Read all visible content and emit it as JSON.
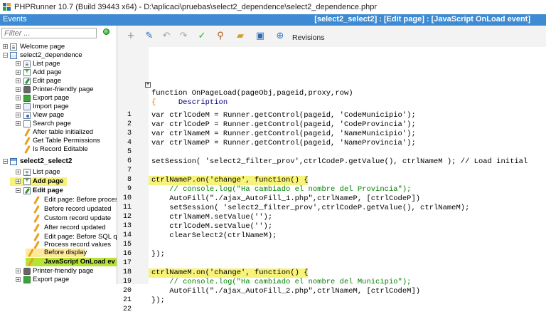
{
  "window": {
    "title": "PHPRunner 10.7 (Build 39443 x64) - D:\\aplicaci\\pruebas\\select2_dependence\\select2_dependence.phpr"
  },
  "events_header": {
    "label": "Events",
    "context": "[select2_select2] : [Edit page] : [JavaScript OnLoad event]"
  },
  "filter": {
    "placeholder": "Filter ..."
  },
  "tree": [
    {
      "label": "Welcome page"
    },
    {
      "label": "select2_dependence"
    },
    {
      "label": "List page"
    },
    {
      "label": "Add page"
    },
    {
      "label": "Edit page"
    },
    {
      "label": "Printer-friendly page"
    },
    {
      "label": "Export page"
    },
    {
      "label": "Import page"
    },
    {
      "label": "View page"
    },
    {
      "label": "Search page"
    },
    {
      "label": "After table initialized"
    },
    {
      "label": "Get Table Permissions"
    },
    {
      "label": "Is Record Editable"
    },
    {
      "label": "select2_select2"
    },
    {
      "label": "List page"
    },
    {
      "label": "Add page"
    },
    {
      "label": "Edit page"
    },
    {
      "label": "Edit page: Before proces"
    },
    {
      "label": "Before record updated"
    },
    {
      "label": "Custom record update"
    },
    {
      "label": "After record updated"
    },
    {
      "label": "Edit page: Before SQL qu"
    },
    {
      "label": "Process record values"
    },
    {
      "label": "Before display"
    },
    {
      "label": "JavaScript OnLoad ev"
    },
    {
      "label": "Printer-friendly page"
    },
    {
      "label": "Export page"
    }
  ],
  "toolbar": {
    "revisions_label": "Revisions",
    "icons": [
      "plus-icon",
      "pencil-icon",
      "undo-icon",
      "redo-icon",
      "check-icon",
      "magnifier-icon",
      "folder-icon",
      "image-icon",
      "revisions-icon"
    ]
  },
  "editor": {
    "description_label": "Description",
    "header_lines": [
      "function OnPageLoad(pageObj,pageid,proxy,row)",
      "{"
    ],
    "line_numbers": [
      "1",
      "2",
      "3",
      "4",
      "5",
      "6",
      "7",
      "8",
      "9",
      "10",
      "11",
      "12",
      "13",
      "14",
      "15",
      "16",
      "17",
      "18",
      "19",
      "20",
      "21",
      "22"
    ],
    "lines": [
      "var ctrlCodeM = Runner.getControl(pageid, 'CodeMunicipio');",
      "var ctrlCodeP = Runner.getControl(pageid, 'CodeProvincia');",
      "var ctrlNameM = Runner.getControl(pageid, 'NameMunicipio');",
      "var ctrlNameP = Runner.getControl(pageid, 'NameProvincia');",
      "",
      "setSession( 'select2_filter_prov',ctrlCodeP.getValue(), ctrlNameM ); // Load initial",
      "",
      "ctrlNameP.on('change', function() {",
      "    // console.log(\"Ha cambiado el nombre del Provincia\");",
      "    AutoFill(\"./ajax_AutoFill_1.php\",ctrlNameP, [ctrlCodeP])",
      "    setSession( 'select2_filter_prov',ctrlCodeP.getValue(), ctrlNameM);",
      "    ctrlNameM.setValue('');",
      "    ctrlCodeM.setValue('');",
      "    clearSelect2(ctrlNameM);",
      "",
      "});",
      "",
      "ctrlNameM.on('change', function() {",
      "    // console.log(\"Ha cambiado el nombre del Municipio\");",
      "    AutoFill(\"./ajax_AutoFill_2.php\",ctrlNameM, [ctrlCodeM])",
      "});",
      ""
    ]
  }
}
